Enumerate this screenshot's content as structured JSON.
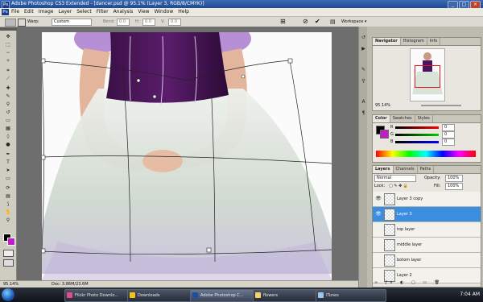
{
  "window": {
    "title": "Adobe Photoshop CS3 Extended - [dancer.psd @ 95.1% (Layer 3, RGB/8/CMYK)]",
    "app_badge": "Ps"
  },
  "menu": [
    "File",
    "Edit",
    "Image",
    "Layer",
    "Select",
    "Filter",
    "Analysis",
    "View",
    "Window",
    "Help"
  ],
  "options": {
    "warp_label": "Warp:",
    "warp_value": "Custom",
    "bend_label": "Bend:",
    "bend_value": "0.0",
    "h_label": "H:",
    "h_value": "0.0",
    "v_label": "V:",
    "v_value": "0.0",
    "workspace_label": "Workspace ▾"
  },
  "status": {
    "zoom": "95.14%",
    "doc": "Doc: 3.86M/23.6M"
  },
  "navigator": {
    "tabs": [
      "Navigator",
      "Histogram",
      "Info"
    ],
    "zoom": "95.14%"
  },
  "color_panel": {
    "tabs": [
      "Color",
      "Swatches",
      "Styles"
    ],
    "r_label": "R",
    "g_label": "G",
    "b_label": "B",
    "r_value": "0",
    "g_value": "0",
    "b_value": "0",
    "foreground": "#000000",
    "background": "#c21cc8"
  },
  "layers_panel": {
    "tabs": [
      "Layers",
      "Channels",
      "Paths"
    ],
    "blend_mode": "Normal",
    "opacity_label": "Opacity:",
    "opacity_value": "100%",
    "lock_label": "Lock:",
    "fill_label": "Fill:",
    "fill_value": "100%",
    "layers": [
      {
        "name": "Layer 3 copy",
        "visible": true,
        "selected": false
      },
      {
        "name": "Layer 3",
        "visible": true,
        "selected": true
      },
      {
        "name": "top layer",
        "visible": false,
        "selected": false
      },
      {
        "name": "middle layer",
        "visible": false,
        "selected": false
      },
      {
        "name": "botom layer",
        "visible": false,
        "selected": false
      },
      {
        "name": "Layer 2",
        "visible": false,
        "selected": false
      }
    ]
  },
  "taskbar": {
    "items": [
      {
        "label": "Flickr Photo Downlo...",
        "color": "#e04b8c"
      },
      {
        "label": "Downloads",
        "color": "#f0c419"
      },
      {
        "label": "Adobe Photoshop C...",
        "color": "#1a4ea1",
        "active": true
      },
      {
        "label": "flowers",
        "color": "#f3d36a"
      },
      {
        "label": "iTunes",
        "color": "#9bc7ee"
      }
    ],
    "clock": "7:04 AM"
  }
}
